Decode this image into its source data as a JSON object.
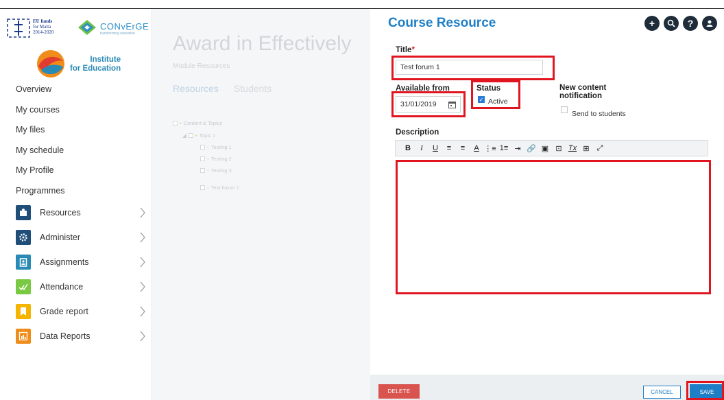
{
  "logos": {
    "eu_text_1": "EU funds",
    "eu_text_2": "for Malta",
    "eu_text_3": "2014-2020",
    "converge": "CONvErGE",
    "converge_sub": "transforming education",
    "institute_1": "Institute",
    "institute_2": "for Education"
  },
  "sidebar": {
    "links": [
      "Overview",
      "My courses",
      "My files",
      "My schedule",
      "My Profile",
      "Programmes"
    ],
    "items": [
      {
        "label": "Resources",
        "icon": "resources-icon",
        "color": "#1f4e79"
      },
      {
        "label": "Administer",
        "icon": "gear-icon",
        "color": "#1f4e79"
      },
      {
        "label": "Assignments",
        "icon": "clipboard-icon",
        "color": "#2a8ab6"
      },
      {
        "label": "Attendance",
        "icon": "check-icon",
        "color": "#7ac943"
      },
      {
        "label": "Grade report",
        "icon": "bookmark-icon",
        "color": "#f5b400"
      },
      {
        "label": "Data Reports",
        "icon": "chart-icon",
        "color": "#f08c1a"
      }
    ]
  },
  "background_page": {
    "title": "Award in Effectively",
    "subtitle": "Module Resources",
    "tabs": [
      "Resources",
      "Students"
    ],
    "tree": [
      "Content & Topics",
      "Topic 1",
      "Testing 1",
      "Testing 2",
      "Testing 3",
      "Test forum 1"
    ]
  },
  "modal": {
    "title": "Course Resource",
    "header_icons": [
      "add-icon",
      "search-icon",
      "help-icon",
      "user-icon"
    ],
    "title_label": "Title",
    "title_required_mark": "*",
    "title_value": "Test forum 1",
    "available_from_label": "Available from",
    "available_from_value": "31/01/2019",
    "status_label": "Status",
    "status_option": "Active",
    "notification_label_1": "New content",
    "notification_label_2": "notification",
    "notification_option": "Send to students",
    "description_label": "Description",
    "toolbar": [
      "B",
      "I",
      "U",
      "≡",
      "≡",
      "A",
      "⋮≡",
      "1≡",
      "⇥",
      "🔗",
      "▣",
      "⊡",
      "Tx",
      "⊞",
      "⤢"
    ],
    "delete_label": "DELETE",
    "cancel_label": "CANCEL",
    "save_label": "SAVE"
  },
  "colors": {
    "accent": "#1e7fc6",
    "highlight": "#e0151f",
    "delete": "#d9534f"
  }
}
